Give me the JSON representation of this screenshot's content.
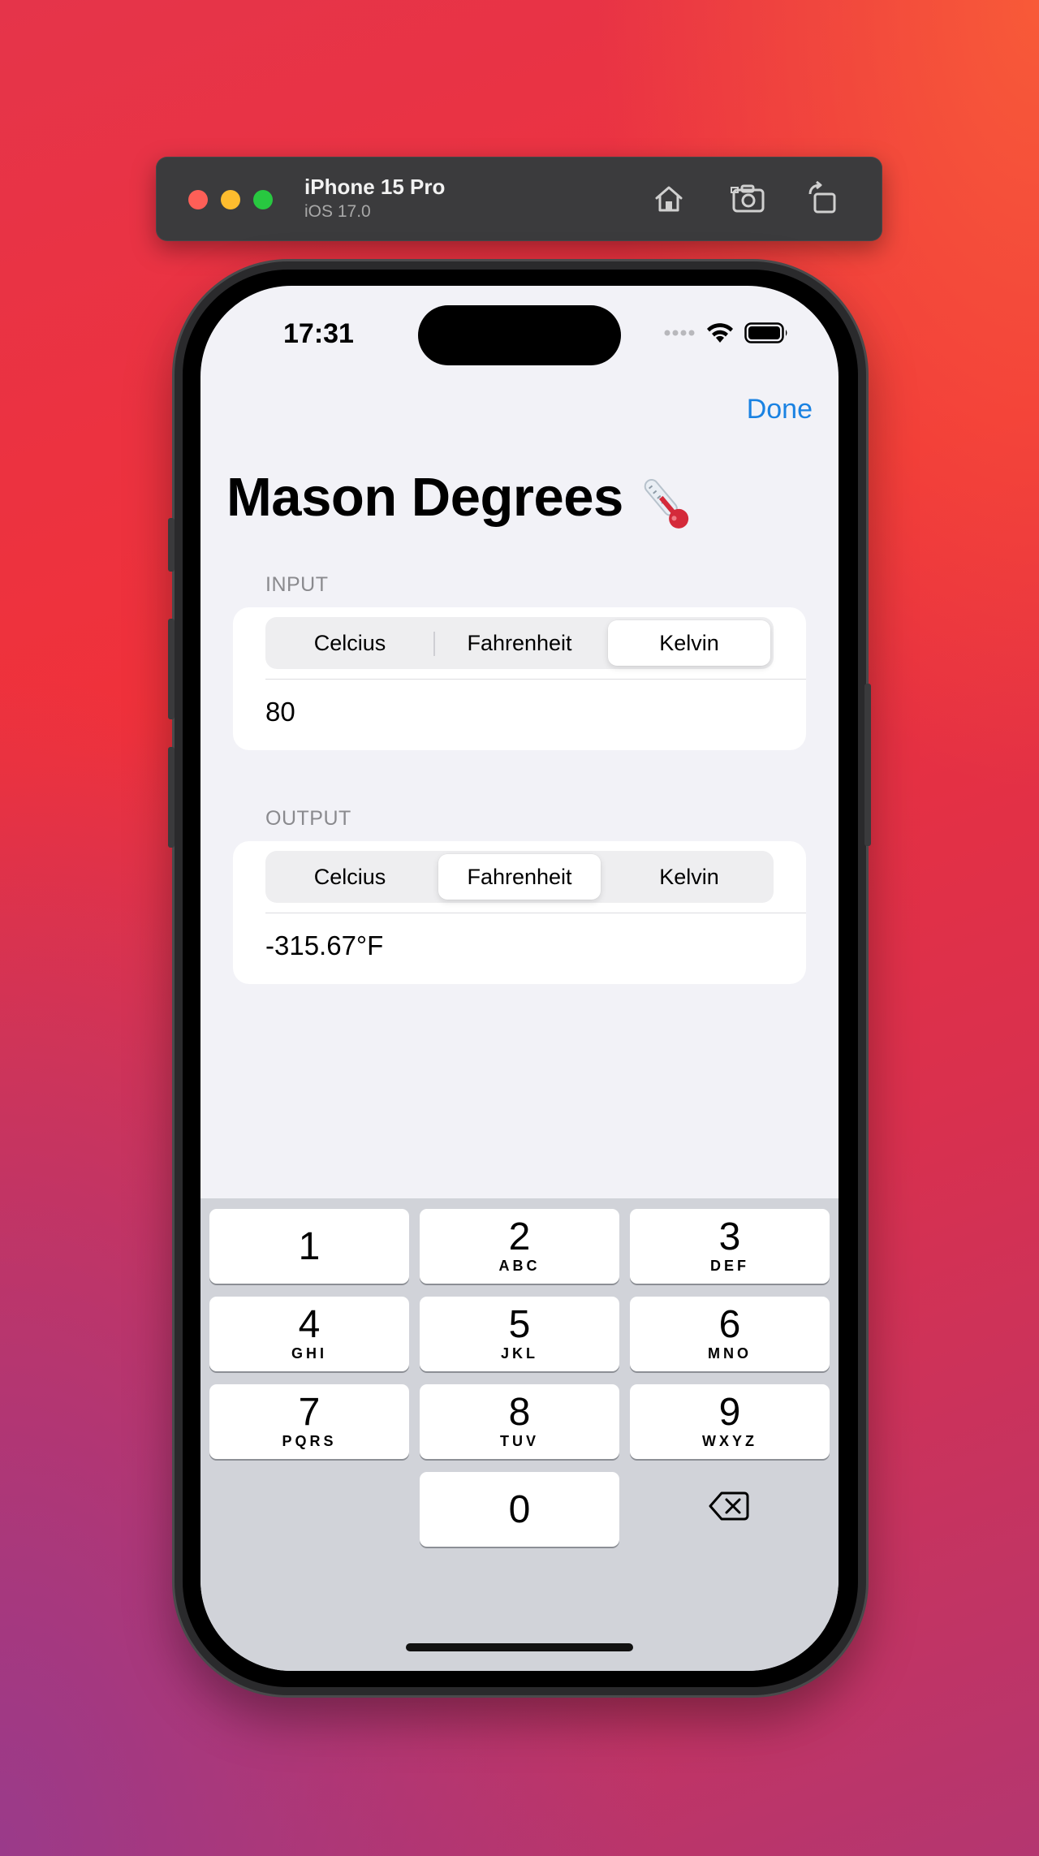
{
  "simulator": {
    "device_name": "iPhone 15 Pro",
    "os_version": "iOS 17.0"
  },
  "status_bar": {
    "time": "17:31"
  },
  "nav": {
    "done_label": "Done"
  },
  "app": {
    "title": "Mason Degrees",
    "title_emoji": "thermometer-icon"
  },
  "input_section": {
    "label": "INPUT",
    "segments": [
      "Celcius",
      "Fahrenheit",
      "Kelvin"
    ],
    "selected": "Kelvin",
    "value": "80"
  },
  "output_section": {
    "label": "OUTPUT",
    "segments": [
      "Celcius",
      "Fahrenheit",
      "Kelvin"
    ],
    "selected": "Fahrenheit",
    "value": "-315.67°F"
  },
  "keypad": {
    "keys": [
      {
        "num": "1",
        "letters": ""
      },
      {
        "num": "2",
        "letters": "ABC"
      },
      {
        "num": "3",
        "letters": "DEF"
      },
      {
        "num": "4",
        "letters": "GHI"
      },
      {
        "num": "5",
        "letters": "JKL"
      },
      {
        "num": "6",
        "letters": "MNO"
      },
      {
        "num": "7",
        "letters": "PQRS"
      },
      {
        "num": "8",
        "letters": "TUV"
      },
      {
        "num": "9",
        "letters": "WXYZ"
      },
      {
        "num": "0",
        "letters": ""
      }
    ],
    "delete_icon": "delete-backward-icon"
  },
  "colors": {
    "accent": "#1a82e2",
    "screen_bg": "#f2f2f7",
    "keypad_bg": "#d1d3d9"
  }
}
